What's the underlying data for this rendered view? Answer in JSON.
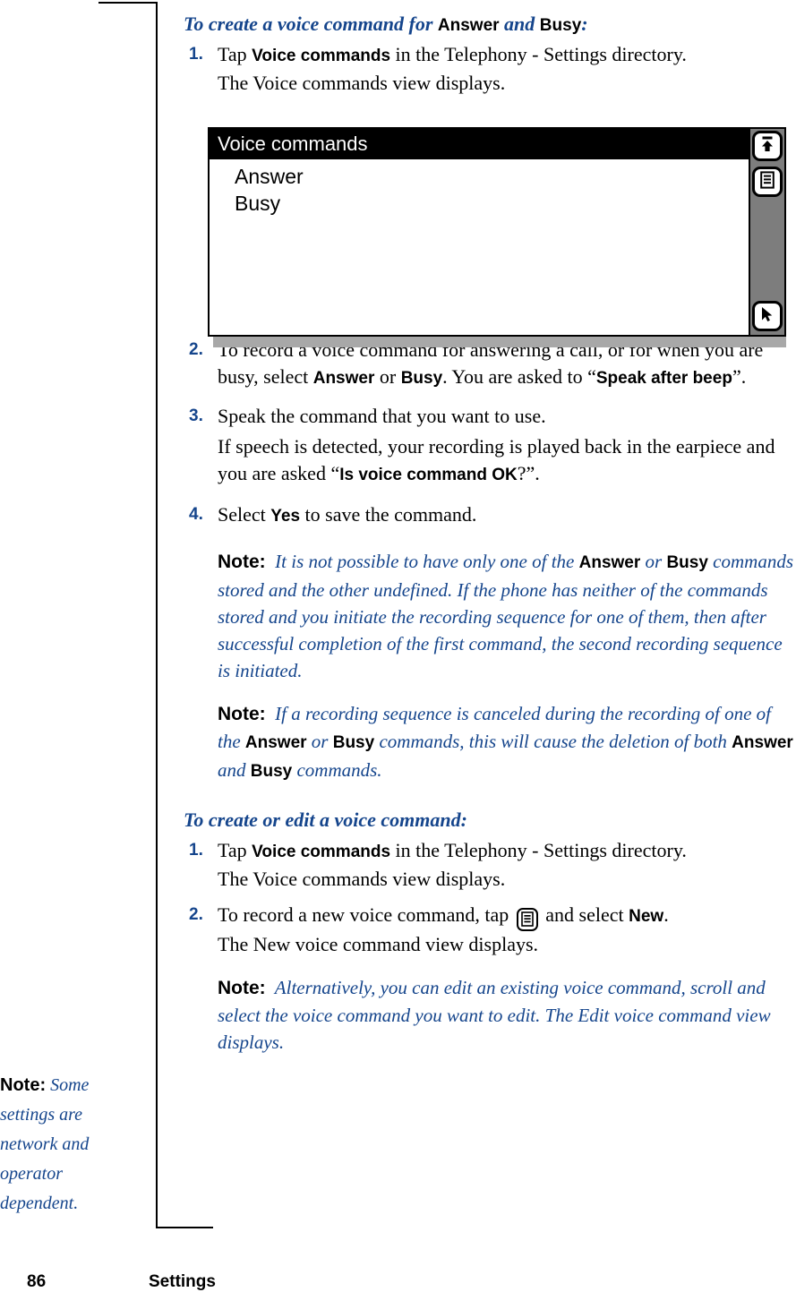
{
  "page": {
    "number": "86",
    "section": "Settings",
    "accent_color": "#15458C",
    "text_color": "#000000"
  },
  "margin_note": {
    "label": "Note:",
    "text": "Some settings are network and operator dependent."
  },
  "procedure1": {
    "heading_parts": {
      "lead": "To create a voice command for ",
      "ui1": "Answer",
      "conj": " and ",
      "ui2": "Busy",
      "tail": ":"
    },
    "steps": [
      {
        "num": "1.",
        "line1_a": "Tap ",
        "line1_ui": "Voice commands",
        "line1_b": " in the Telephony - Settings directory.",
        "line2": "The Voice commands view displays."
      },
      {
        "num": "2.",
        "a": "To record a voice command for answering a call, or for when you are busy, select ",
        "ui1": "Answer",
        "b": " or ",
        "ui2": "Busy",
        "c": ". You are asked to “",
        "ui3": "Speak after beep",
        "d": "”."
      },
      {
        "num": "3.",
        "a": "Speak the command that you want to use.",
        "cont_a": "If speech is detected, your recording is played back in the earpiece and you are asked “",
        "cont_ui": "Is voice command OK",
        "cont_b": "?”."
      },
      {
        "num": "4.",
        "a": "Select ",
        "ui1": "Yes",
        "b": " to save the command."
      }
    ],
    "notes": [
      {
        "label": "Note:",
        "a": "It is not possible to have only one of the ",
        "ui1": "Answer",
        "b": " or ",
        "ui2": "Busy",
        "c": " commands stored and the other undefined. If the phone has neither of the commands stored and you initiate the recording sequence for one of them, then after successful completion of the first command, the second recording sequence is initiated."
      },
      {
        "label": "Note:",
        "a": "If a recording sequence is canceled during the recording of one of the ",
        "ui1": "Answer",
        "b": " or ",
        "ui2": "Busy",
        "c": " commands, this will cause the deletion of both ",
        "ui3": "Answer",
        "d": " and ",
        "ui4": "Busy",
        "e": " commands."
      }
    ]
  },
  "procedure2": {
    "heading": "To create or edit a voice command:",
    "steps": [
      {
        "num": "1.",
        "line1_a": "Tap ",
        "line1_ui": "Voice commands",
        "line1_b": " in the Telephony - Settings directory.",
        "line2": "The Voice commands view displays."
      },
      {
        "num": "2.",
        "a": "To record a new voice command, tap ",
        "icon": "menu-list-icon",
        "b": " and select  ",
        "ui1": "New",
        "c": ".",
        "line2": "The New voice command view displays."
      }
    ],
    "note": {
      "label": "Note:",
      "text": "Alternatively, you can edit an existing voice command, scroll and select the voice command you want to edit. The Edit voice command view displays."
    }
  },
  "figure": {
    "title": "Voice commands",
    "list_items": [
      "Answer",
      "Busy"
    ],
    "toolbar_buttons": [
      {
        "icon": "exit-up-arrow-icon"
      },
      {
        "icon": "menu-list-icon"
      },
      {
        "icon": "cursor-pointer-icon"
      }
    ]
  }
}
